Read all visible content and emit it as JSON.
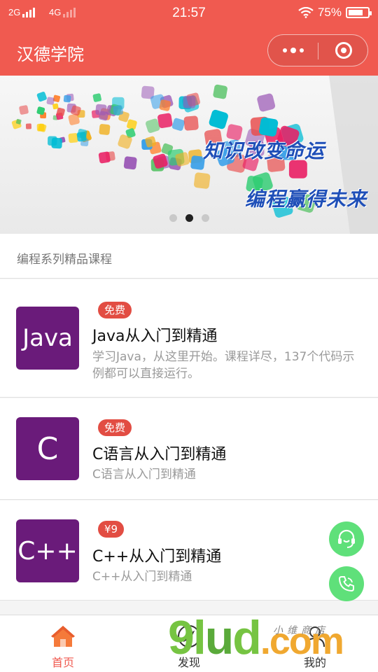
{
  "status_bar": {
    "signal_left": "2G",
    "signal_right": "4G",
    "time": "21:57",
    "battery_percent": "75%",
    "battery_level": 0.75
  },
  "nav": {
    "title": "汉德学院"
  },
  "banner": {
    "slogan_line1": "知识改变命运",
    "slogan_line2": "编程赢得未来",
    "slide_count": 3,
    "active_slide": 2
  },
  "section": {
    "title": "编程系列精品课程"
  },
  "courses": [
    {
      "thumb_text": "Java",
      "tag": "免费",
      "title": "Java从入门到精通",
      "desc": "学习Java，从这里开始。课程详尽，137个代码示例都可以直接运行。"
    },
    {
      "thumb_text": "C",
      "tag": "免费",
      "title": "C语言从入门到精通",
      "desc": "C语言从入门到精通"
    },
    {
      "thumb_text": "C++",
      "tag": "¥9",
      "title": "C++从入门到精通",
      "desc": "C++从入门到精通"
    }
  ],
  "floating": {
    "service_icon": "customer-service-icon",
    "phone_icon": "phone-icon"
  },
  "tabbar": {
    "items": [
      {
        "label": "首页",
        "icon": "home-icon",
        "active": true
      },
      {
        "label": "发现",
        "icon": "compass-icon",
        "active": false
      },
      {
        "label": "我的",
        "icon": "user-icon",
        "active": false
      }
    ]
  },
  "watermark": {
    "main": "9lud.com",
    "sub": "小维商店"
  },
  "colors": {
    "theme_red": "#f05a50",
    "thumb_purple": "#6a1b7a",
    "tag_red": "#e24d43",
    "float_green": "#5fe07a"
  }
}
